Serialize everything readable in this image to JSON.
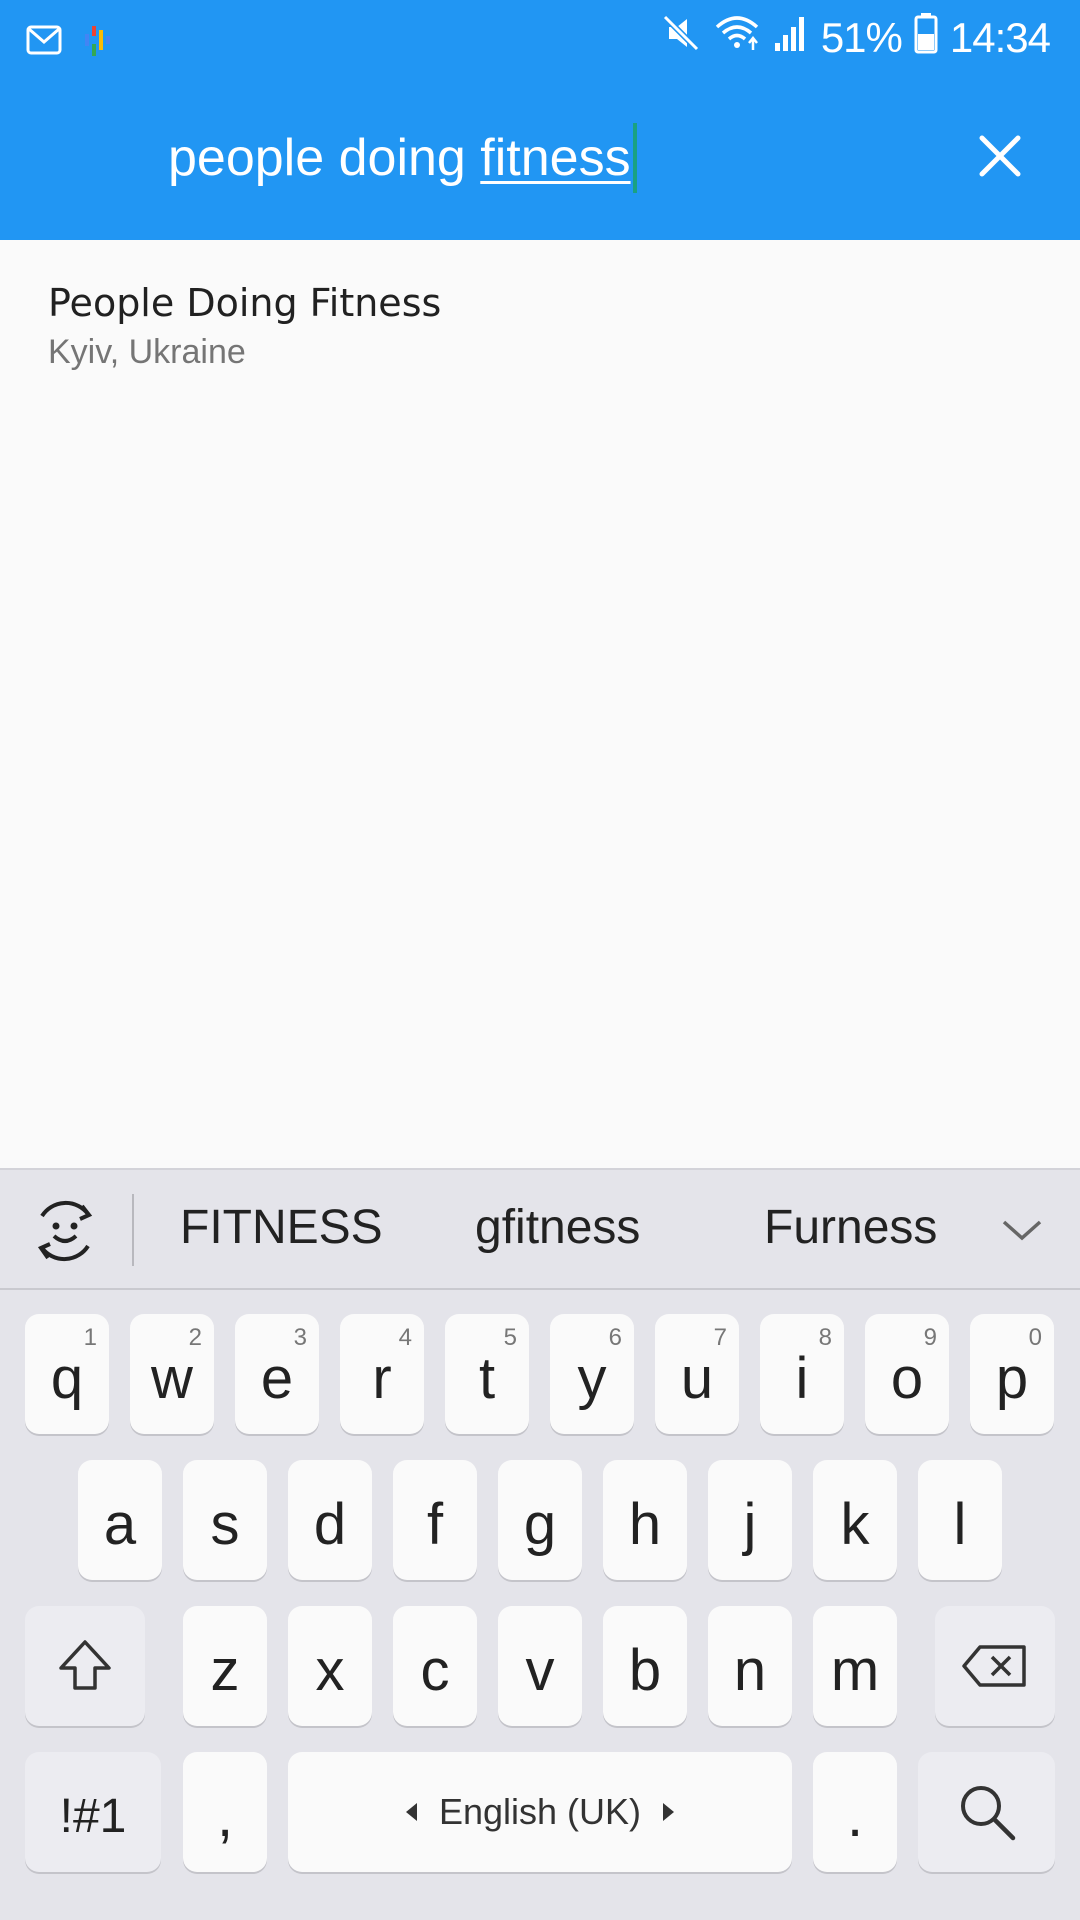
{
  "status_bar": {
    "notification_icons": [
      "gmail-icon",
      "podcast-icon"
    ],
    "system_icons": [
      "mute-icon",
      "wifi-icon",
      "signal-icon",
      "battery-icon"
    ],
    "battery_percent": "51%",
    "time": "14:34"
  },
  "search": {
    "query_prefix": "people doing ",
    "query_composing": "fitness",
    "clear_icon": "close-icon"
  },
  "results": [
    {
      "title": "People Doing Fitness",
      "subtitle": "Kyiv, Ukraine"
    }
  ],
  "keyboard": {
    "suggestions": [
      "FITNESS",
      "gfitness",
      "Furness"
    ],
    "row1": [
      {
        "key": "q",
        "hint": "1"
      },
      {
        "key": "w",
        "hint": "2"
      },
      {
        "key": "e",
        "hint": "3"
      },
      {
        "key": "r",
        "hint": "4"
      },
      {
        "key": "t",
        "hint": "5"
      },
      {
        "key": "y",
        "hint": "6"
      },
      {
        "key": "u",
        "hint": "7"
      },
      {
        "key": "i",
        "hint": "8"
      },
      {
        "key": "o",
        "hint": "9"
      },
      {
        "key": "p",
        "hint": "0"
      }
    ],
    "row2": [
      "a",
      "s",
      "d",
      "f",
      "g",
      "h",
      "j",
      "k",
      "l"
    ],
    "row3": [
      "z",
      "x",
      "c",
      "v",
      "b",
      "n",
      "m"
    ],
    "symbols_label": "!#1",
    "comma_label": ",",
    "space_label": "English (UK)",
    "period_label": ".",
    "colors": {
      "key_background": "#fafafa",
      "keyboard_background": "#e4e4ea"
    }
  },
  "colors": {
    "app_bar": "#2196f3",
    "caret": "#1aa182"
  }
}
